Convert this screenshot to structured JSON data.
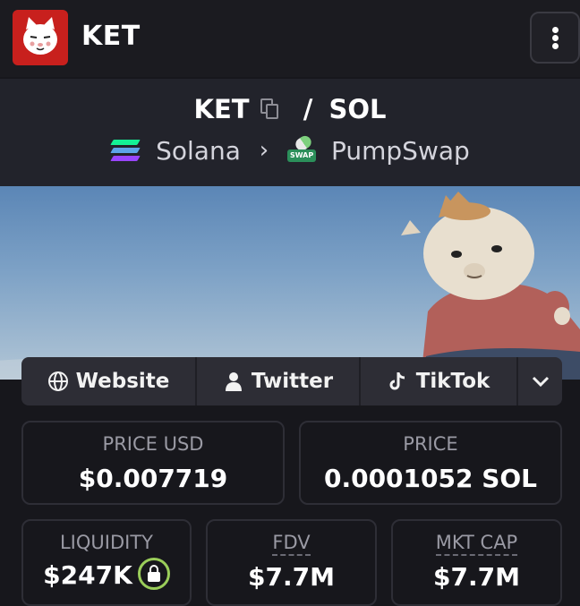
{
  "header": {
    "app_name": "KET",
    "logo_icon": "cat-face-icon",
    "menu_icon": "vertical-dots-icon",
    "brand_color": "#c8201d"
  },
  "pair": {
    "base": "KET",
    "separator": "/",
    "quote": "SOL",
    "chain": "Solana",
    "dex": "PumpSwap",
    "dex_badge": "SWAP"
  },
  "links": [
    {
      "label": "Website",
      "icon": "globe-icon"
    },
    {
      "label": "Twitter",
      "icon": "user-icon"
    },
    {
      "label": "TikTok",
      "icon": "tiktok-icon"
    },
    {
      "label": "",
      "icon": "chevron-down-icon"
    }
  ],
  "stats": {
    "price_usd": {
      "label": "PRICE USD",
      "value": "$0.007719"
    },
    "price_native": {
      "label": "PRICE",
      "value": "0.0001052 SOL"
    },
    "liquidity": {
      "label": "LIQUIDITY",
      "value": "$247K",
      "locked": true,
      "lock_color": "#9acd5a"
    },
    "fdv": {
      "label": "FDV",
      "value": "$7.7M"
    },
    "mkt_cap": {
      "label": "MKT CAP",
      "value": "$7.7M"
    }
  }
}
